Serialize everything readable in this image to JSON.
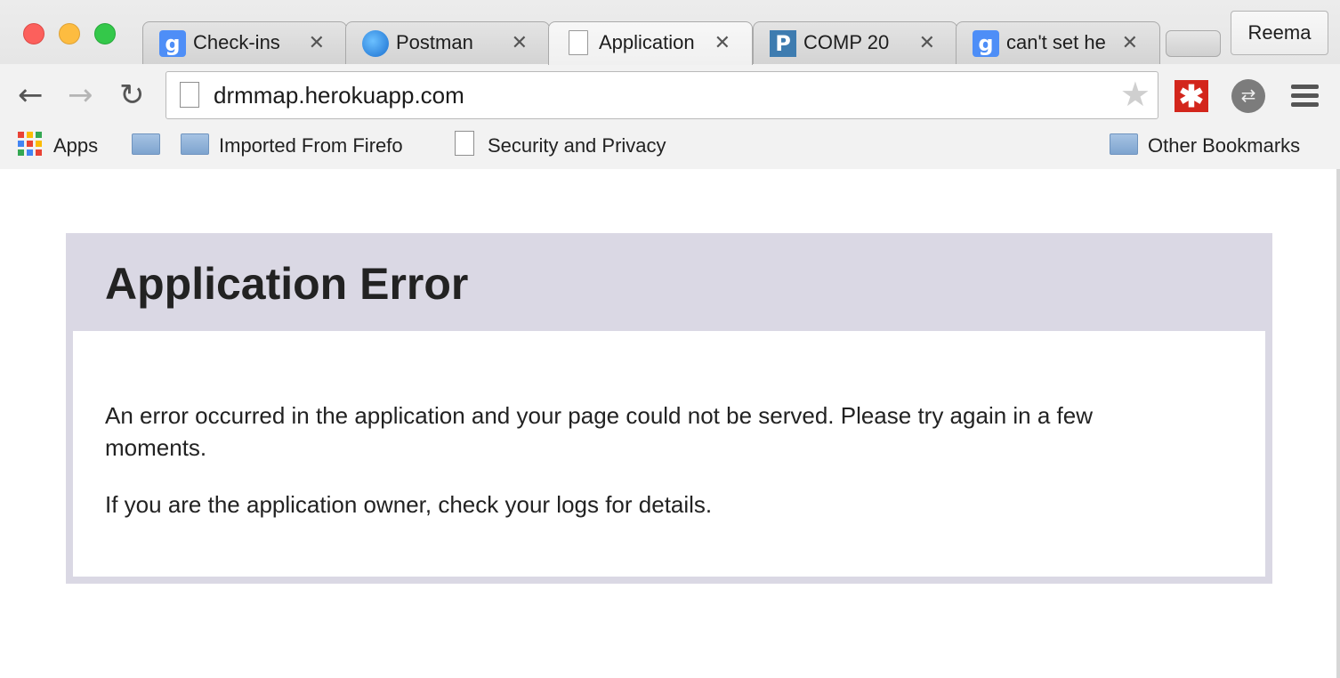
{
  "window": {
    "tabs": [
      {
        "label": "Check-ins",
        "icon": "google-icon"
      },
      {
        "label": "Postman",
        "icon": "globe-icon"
      },
      {
        "label": "Application",
        "icon": "page-icon"
      },
      {
        "label": "COMP 20",
        "icon": "piazza-icon"
      },
      {
        "label": "can't set he",
        "icon": "google-icon"
      }
    ],
    "active_tab": 2,
    "profile_name": "Reema"
  },
  "toolbar": {
    "url": "drmmap.herokuapp.com"
  },
  "bookmarks": {
    "apps_label": "Apps",
    "items": [
      {
        "label": "",
        "icon": "folder-icon"
      },
      {
        "label": "Imported From Firefo",
        "icon": "folder-icon"
      },
      {
        "label": "Security and Privacy",
        "icon": "page-icon"
      }
    ],
    "other_label": "Other Bookmarks"
  },
  "page": {
    "title": "Application Error",
    "message": "An error occurred in the application and your page could not be served. Please try again in a few moments.",
    "hint": "If you are the application owner, check your logs for details."
  },
  "colors": {
    "error_frame": "#dad8e4",
    "ext_red": "#d3261c"
  }
}
